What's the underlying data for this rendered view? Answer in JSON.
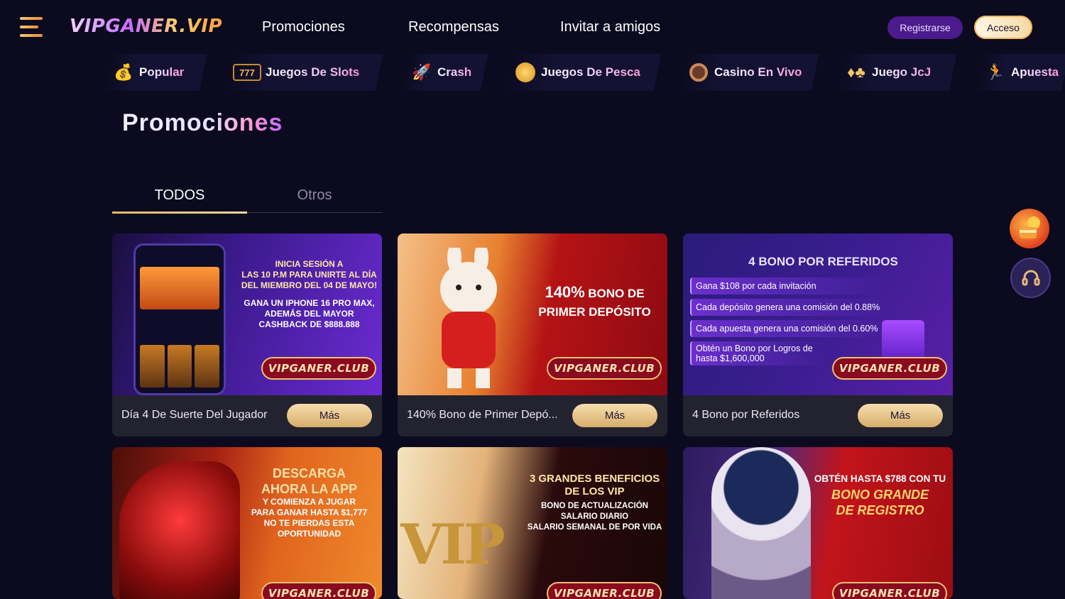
{
  "header": {
    "logo": "VIPGANER.VIP",
    "nav": [
      "Promociones",
      "Recompensas",
      "Invitar a amigos"
    ],
    "register_label": "Registrarse",
    "login_label": "Acceso"
  },
  "categories": [
    {
      "label": "Popular",
      "icon": "money-bag-icon"
    },
    {
      "label": "Juegos De Slots",
      "icon": "slot-777-icon"
    },
    {
      "label": "Crash",
      "icon": "rocket-icon"
    },
    {
      "label": "Juegos De Pesca",
      "icon": "fish-coin-icon"
    },
    {
      "label": "Casino En Vivo",
      "icon": "chip-icon"
    },
    {
      "label": "Juego JcJ",
      "icon": "cards-icon"
    },
    {
      "label": "Apuesta",
      "icon": "athlete-icon"
    }
  ],
  "page_title": "Promociones",
  "tabs": {
    "todos": "TODOS",
    "otros": "Otros"
  },
  "cards": [
    {
      "title": "Día 4 De Suerte Del Jugador",
      "more": "Más",
      "banner_lines": [
        "INICIA SESIÓN A",
        "LAS 10 P.M PARA UNIRTE AL DÍA",
        "DEL MIEMBRO DEL 04 DE MAYO!",
        "GANA UN IPHONE 16 PRO MAX,",
        "ADEMÁS DEL MAYOR",
        "CASHBACK DE $888.888"
      ],
      "brand": "VIPGANER.CLUB"
    },
    {
      "title": "140% Bono de Primer Depó...",
      "more": "Más",
      "banner_big": "140%",
      "banner_rest": "BONO DE",
      "banner_line2": "PRIMER DEPÓSITO",
      "brand": "VIPGANER.CLUB"
    },
    {
      "title": "4 Bono por Referidos",
      "more": "Más",
      "banner_title": "4 BONO POR REFERIDOS",
      "banner_items": [
        "Gana $108 por cada invitación",
        "Cada depósito genera una comisión del 0.88%",
        "Cada apuesta genera una comisión del 0.60%",
        "Obtén un Bono por Logros de hasta $1,600,000"
      ],
      "brand": "VIPGANER.CLUB"
    },
    {
      "banner_big": "DESCARGA",
      "banner_big2": "AHORA LA APP",
      "banner_lines": [
        "Y COMIENZA A JUGAR",
        "PARA GANAR HASTA $1,777",
        "NO TE PIERDAS ESTA",
        "OPORTUNIDAD"
      ],
      "brand": "VIPGANER.CLUB"
    },
    {
      "banner_title1": "3 GRANDES BENEFICIOS",
      "banner_title2": "DE LOS VIP",
      "banner_lines": [
        "BONO DE ACTUALIZACIÓN",
        "SALARIO DIARIO",
        "SALARIO SEMANAL DE POR VIDA"
      ],
      "vip_text": "VIP",
      "brand": "VIPGANER.CLUB"
    },
    {
      "banner_line1": "OBTÉN HASTA $788 CON TU",
      "banner_big": "BONO GRANDE",
      "banner_big2": "DE REGISTRO",
      "brand": "VIPGANER.CLUB"
    }
  ],
  "floating": {
    "gift_icon": "gift-bag-icon",
    "support_icon": "headset-icon"
  }
}
